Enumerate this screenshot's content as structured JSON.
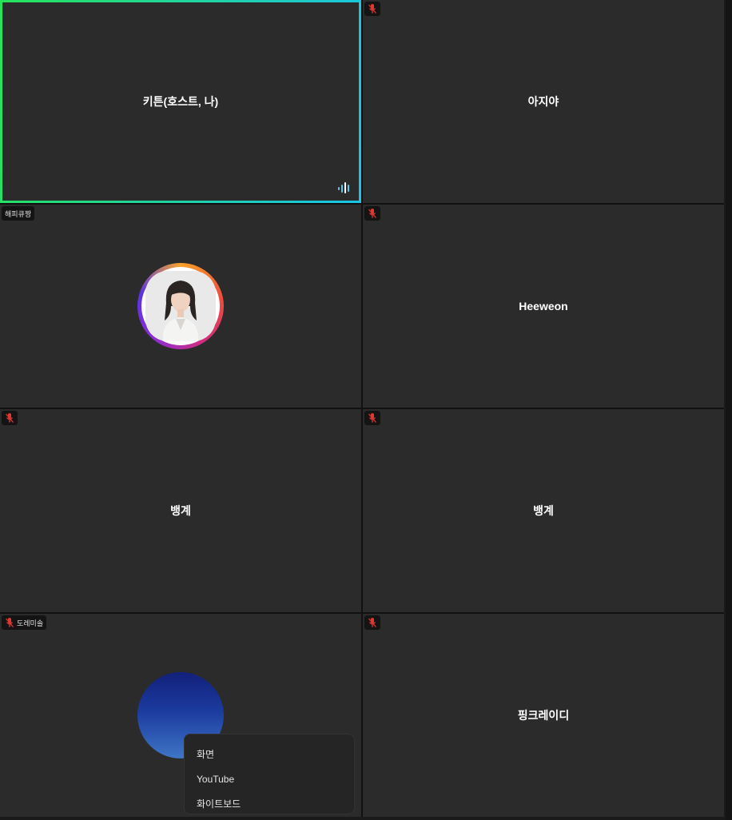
{
  "tiles": [
    {
      "name": "키튼(호스트, 나)",
      "speaking": true
    },
    {
      "name": "아지야",
      "muted": true
    },
    {
      "tag": "해피큐짱",
      "avatar": "photo"
    },
    {
      "name": "Heeweon",
      "muted": true
    },
    {
      "name": "뱅계",
      "muted": true
    },
    {
      "name": "뱅계",
      "muted": true
    },
    {
      "tag": "도레미솔",
      "muted": true,
      "avatar": "blue"
    },
    {
      "name": "핑크레이디",
      "muted": true
    }
  ],
  "menu": {
    "items": [
      "화면",
      "YouTube",
      "화이트보드"
    ]
  },
  "colors": {
    "tile_bg": "#2b2b2b",
    "speaking_border_start": "#27e35a",
    "speaking_border_end": "#19c4e8",
    "muted_mic": "#e03a2f",
    "voice_indicator": "#5ec8e6"
  },
  "icons": {
    "muted": "mic-off-icon",
    "speaking": "audio-level-icon"
  }
}
